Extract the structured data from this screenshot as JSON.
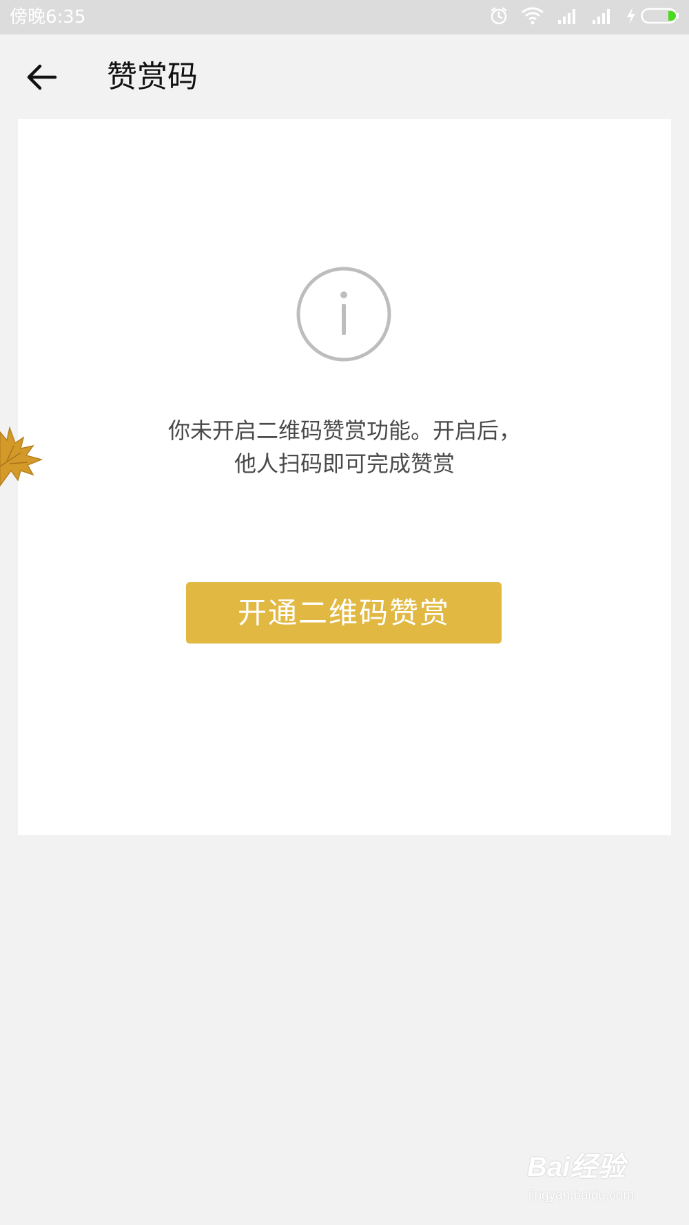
{
  "status_bar": {
    "time": "傍晚6:35",
    "icons": [
      "alarm-icon",
      "wifi-icon",
      "signal-icon",
      "signal-icon",
      "charging-icon",
      "battery-icon"
    ]
  },
  "nav": {
    "back_icon": "arrow-left-icon",
    "title": "赞赏码"
  },
  "card": {
    "icon": "info-icon",
    "message_line1": "你未开启二维码赞赏功能。开启后，",
    "message_line2": "他人扫码即可完成赞赏",
    "button_label": "开通二维码赞赏"
  },
  "watermark": {
    "logo": "Bai经验",
    "url": "jingyan.baidu.com"
  },
  "colors": {
    "background": "#f2f2f2",
    "status_bar": "#dcdcdc",
    "card": "#ffffff",
    "button": "#e1b842",
    "button_text": "#ffffff",
    "icon_gray": "#bdbdbd",
    "message_text": "#4a4a4a"
  }
}
